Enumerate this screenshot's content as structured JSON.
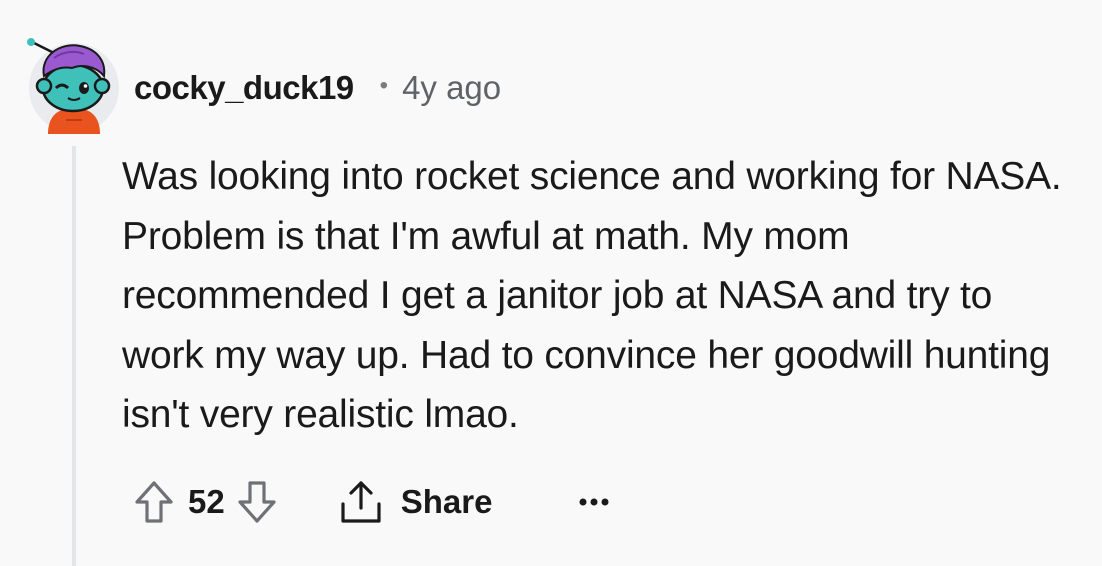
{
  "comment": {
    "username": "cocky_duck19",
    "separator": "•",
    "age": "4y ago",
    "body": "Was looking into rocket science and working for NASA. Problem is that I'm awful at math. My mom recommended I get a janitor job at NASA and try to work my way up. Had to convince her goodwill hunting isn't very realistic lmao.",
    "score": "52",
    "share_label": "Share",
    "avatar_icon": "snoo-avatar-icon",
    "colors": {
      "avatar_bg": "#e9ebee",
      "avatar_skin": "#3fc1b9",
      "avatar_hair": "#9b59d0",
      "avatar_shirt": "#e8531f",
      "thread_line": "#e3e5e9",
      "text": "#1a1a1b",
      "meta": "#5f6368"
    }
  }
}
